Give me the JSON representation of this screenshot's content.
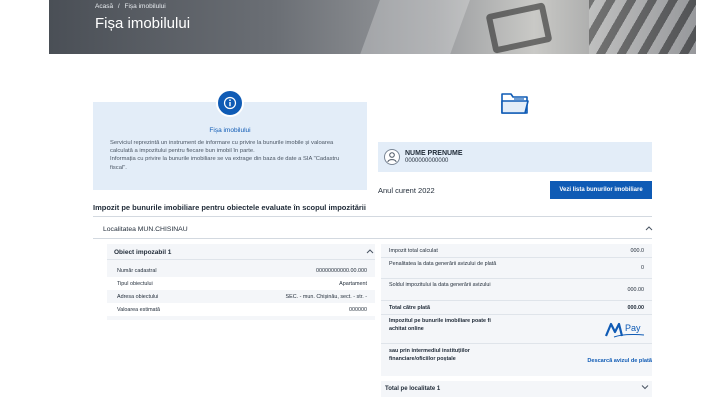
{
  "breadcrumb": {
    "home": "Acasă",
    "separator": "/",
    "current": "Fișa imobilului"
  },
  "page_title": "Fișa imobilului",
  "info": {
    "title": "Fișa imobilului",
    "paragraph1": "Serviciul reprezintă un instrument de informare cu privire la bunurile imobile și valoarea calculată a impozitului pentru fiecare bun imobil în parte.",
    "paragraph2": "Informația cu privire la bunurile imobiliare se va extrage din baza de date a SIA \"Cadastru fiscal\"."
  },
  "user": {
    "name": "NUME PRENUME",
    "idnp": "0000000000000"
  },
  "current_year": "Anul curent 2022",
  "view_button": "Vezi lista bunurilor imobiliare",
  "section_title": "Impozit pe bunurile imobiliare pentru obiectele evaluate în scopul impozitării",
  "locality": "Localitatea MUN.CHISINAU",
  "object": {
    "title": "Obiect impozabil 1",
    "rows": [
      {
        "label": "Număr cadastral",
        "value": "00000000000.00.000"
      },
      {
        "label": "Tipul obiectului",
        "value": "Apartament"
      },
      {
        "label": "Adresa obiectului",
        "value": "SEC. - mun. Chișinău, sect. - str. -"
      },
      {
        "label": "Valoarea estimată",
        "value": "000000"
      }
    ]
  },
  "tax": {
    "total_calculated_label": "Impozit total calculat",
    "total_calculated_value": "000.0",
    "penalty_label": "Penalitatea la data generării avizului de plată",
    "penalty_value": "0",
    "balance_label": "Soldul impozitului la data generării avizului",
    "balance_value": "000.00",
    "total_to_pay_label": "Total către plată",
    "total_to_pay_value": "000.00",
    "online_label": "Impozitul pe bunurile imobiliare poate fi achitat online",
    "institutions_label": "sau prin intermediul instituțiilor financiare/oficiilor poștale",
    "download_link": "Descarcă avizul de plată"
  },
  "mpay": {
    "m": "M",
    "pay": "Pay"
  },
  "total_per_locality": "Total pe localitate 1",
  "icons": [
    "info-icon",
    "folder-icon",
    "user-icon",
    "chevron-up-icon",
    "chevron-down-icon",
    "mpay-logo"
  ],
  "colors": {
    "primary": "#0f5bb5",
    "card_bg": "#e3edf8",
    "row_bg": "#f4f6f9"
  }
}
